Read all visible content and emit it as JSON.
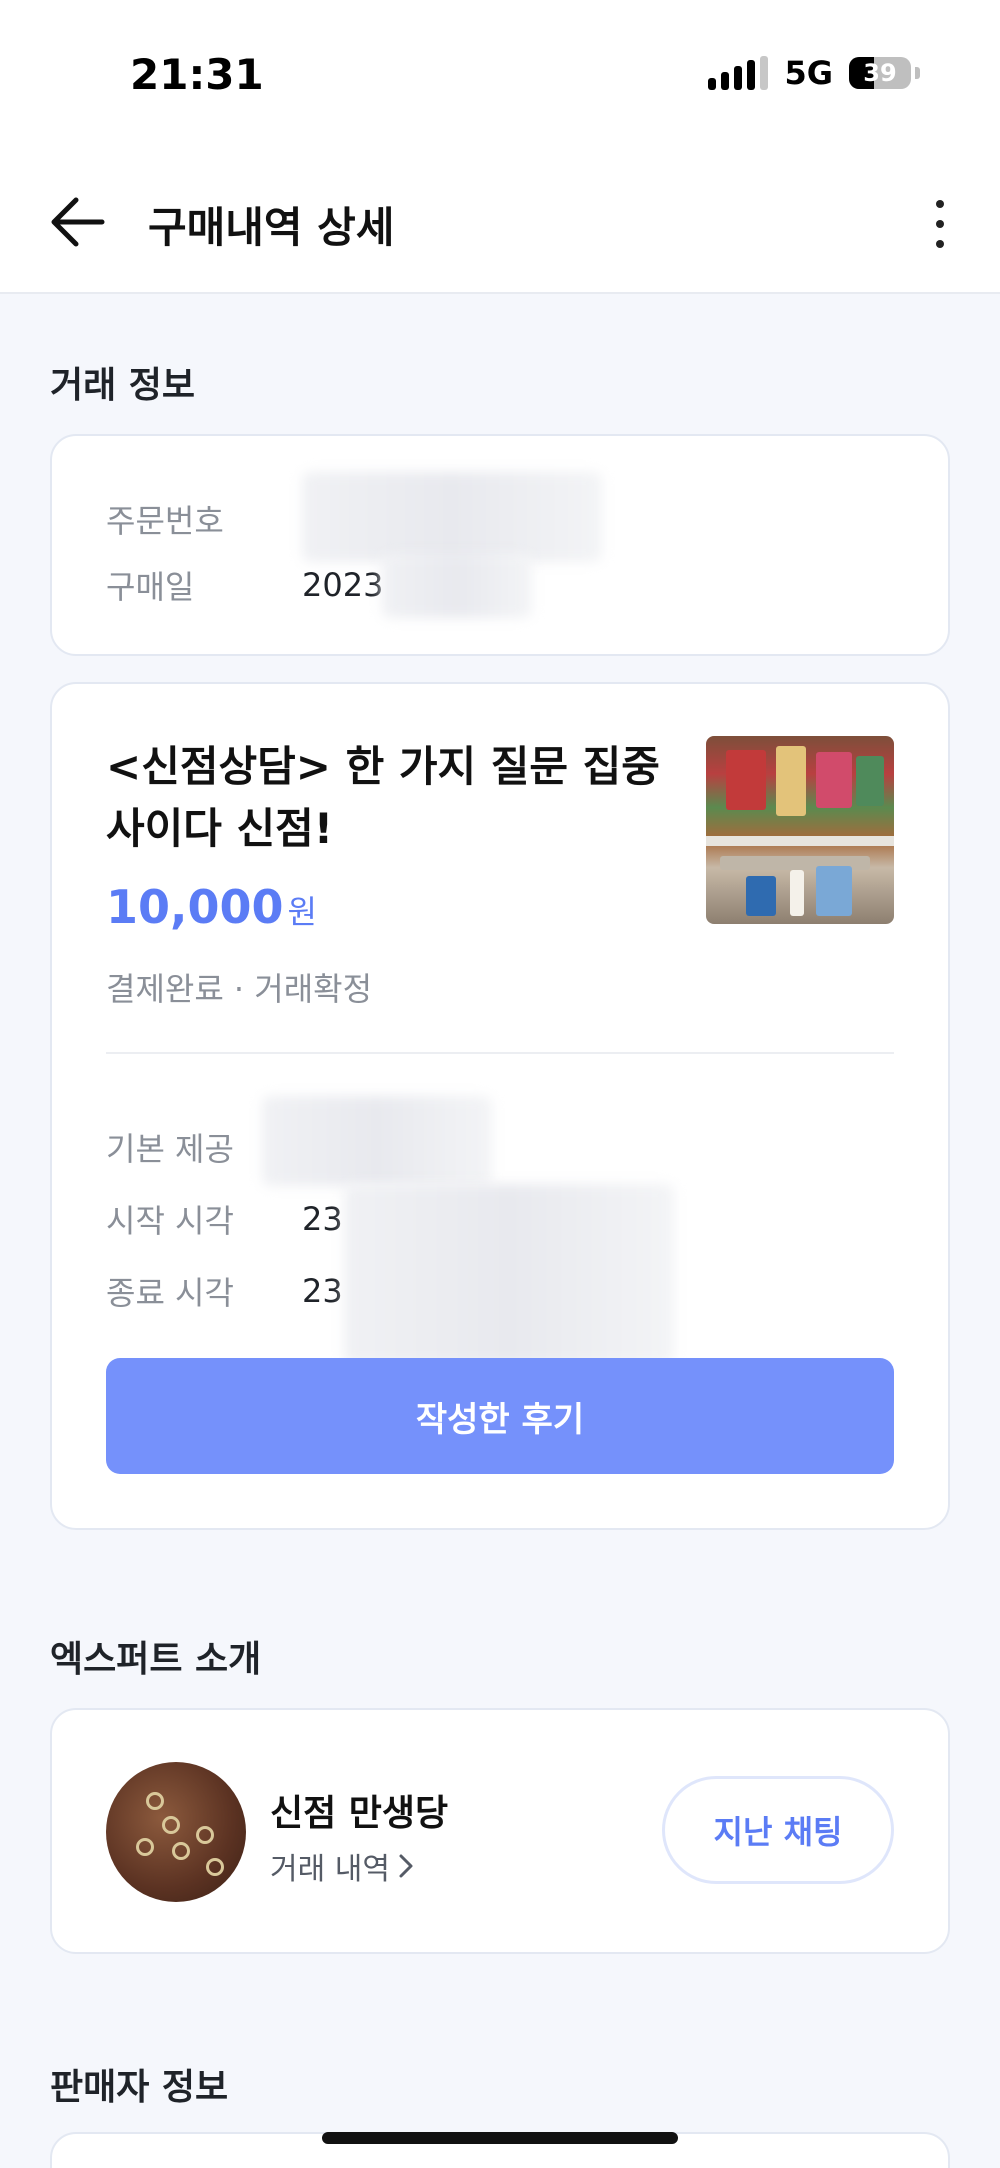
{
  "status_bar": {
    "time": "21:31",
    "network": "5G",
    "battery": "39"
  },
  "header": {
    "title": "구매내역 상세"
  },
  "transaction_info": {
    "section_title": "거래 정보",
    "order_number_label": "주문번호",
    "purchase_date_label": "구매일",
    "purchase_date_value": "2023"
  },
  "product": {
    "title": "<신점상담> 한 가지 질문 집중 사이다 신점!",
    "price": "10,000",
    "price_unit": "원",
    "status": "결제완료 · 거래확정",
    "basic_label": "기본 제공",
    "start_label": "시작 시각",
    "start_value": "23",
    "end_label": "종료 시각",
    "end_value": "23",
    "review_button": "작성한 후기"
  },
  "expert": {
    "section_title": "엑스퍼트 소개",
    "name": "신점 만생당",
    "trade_link": "거래 내역",
    "chat_button": "지난 채팅"
  },
  "seller": {
    "section_title": "판매자 정보"
  },
  "colors": {
    "accent": "#5b7cf5",
    "button": "#7591fb",
    "background": "#f5f7fc"
  }
}
